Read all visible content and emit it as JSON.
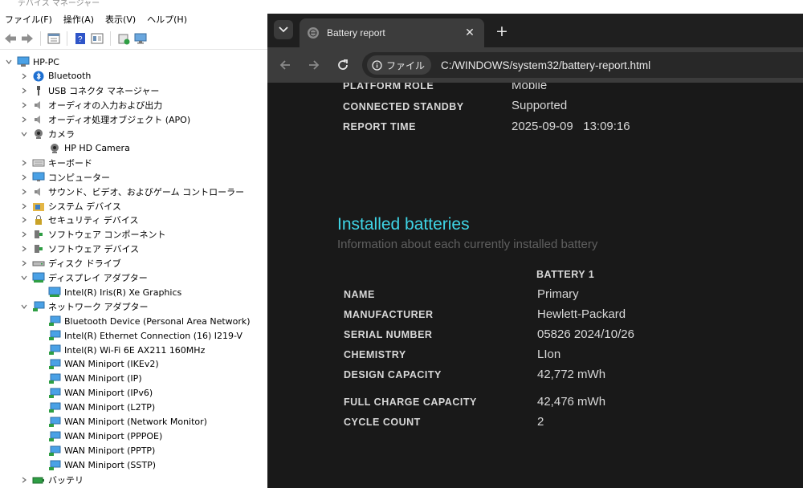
{
  "devmgr": {
    "title": "デバイス マネージャー",
    "menu": [
      "ファイル(F)",
      "操作(A)",
      "表示(V)",
      "ヘルプ(H)"
    ],
    "root": "HP-PC",
    "tree": [
      {
        "label": "Bluetooth",
        "indent": 1,
        "chevron": ">",
        "icon": "bluetooth-icon"
      },
      {
        "label": "USB コネクタ マネージャー",
        "indent": 1,
        "chevron": ">",
        "icon": "usb-icon"
      },
      {
        "label": "オーディオの入力および出力",
        "indent": 1,
        "chevron": ">",
        "icon": "speaker-icon"
      },
      {
        "label": "オーディオ処理オブジェクト (APO)",
        "indent": 1,
        "chevron": ">",
        "icon": "speaker-icon"
      },
      {
        "label": "カメラ",
        "indent": 1,
        "chevron": "v",
        "icon": "camera-icon"
      },
      {
        "label": "HP HD Camera",
        "indent": 2,
        "chevron": "",
        "icon": "camera-icon"
      },
      {
        "label": "キーボード",
        "indent": 1,
        "chevron": ">",
        "icon": "keyboard-icon"
      },
      {
        "label": "コンピューター",
        "indent": 1,
        "chevron": ">",
        "icon": "monitor-icon"
      },
      {
        "label": "サウンド、ビデオ、およびゲーム コントローラー",
        "indent": 1,
        "chevron": ">",
        "icon": "speaker-icon"
      },
      {
        "label": "システム デバイス",
        "indent": 1,
        "chevron": ">",
        "icon": "folder-chip-icon"
      },
      {
        "label": "セキュリティ デバイス",
        "indent": 1,
        "chevron": ">",
        "icon": "lock-icon"
      },
      {
        "label": "ソフトウェア コンポーネント",
        "indent": 1,
        "chevron": ">",
        "icon": "puzzle-icon"
      },
      {
        "label": "ソフトウェア デバイス",
        "indent": 1,
        "chevron": ">",
        "icon": "puzzle-icon"
      },
      {
        "label": "ディスク ドライブ",
        "indent": 1,
        "chevron": ">",
        "icon": "disk-icon"
      },
      {
        "label": "ディスプレイ アダプター",
        "indent": 1,
        "chevron": "v",
        "icon": "display-adapter-icon"
      },
      {
        "label": "Intel(R) Iris(R) Xe Graphics",
        "indent": 2,
        "chevron": "",
        "icon": "display-adapter-icon"
      },
      {
        "label": "ネットワーク アダプター",
        "indent": 1,
        "chevron": "v",
        "icon": "network-icon"
      },
      {
        "label": "Bluetooth Device (Personal Area Network)",
        "indent": 2,
        "chevron": "",
        "icon": "network-icon"
      },
      {
        "label": "Intel(R) Ethernet Connection (16) I219-V",
        "indent": 2,
        "chevron": "",
        "icon": "network-icon"
      },
      {
        "label": "Intel(R) Wi-Fi 6E AX211 160MHz",
        "indent": 2,
        "chevron": "",
        "icon": "network-icon"
      },
      {
        "label": "WAN Miniport (IKEv2)",
        "indent": 2,
        "chevron": "",
        "icon": "network-icon"
      },
      {
        "label": "WAN Miniport (IP)",
        "indent": 2,
        "chevron": "",
        "icon": "network-icon"
      },
      {
        "label": "WAN Miniport (IPv6)",
        "indent": 2,
        "chevron": "",
        "icon": "network-icon"
      },
      {
        "label": "WAN Miniport (L2TP)",
        "indent": 2,
        "chevron": "",
        "icon": "network-icon"
      },
      {
        "label": "WAN Miniport (Network Monitor)",
        "indent": 2,
        "chevron": "",
        "icon": "network-icon"
      },
      {
        "label": "WAN Miniport (PPPOE)",
        "indent": 2,
        "chevron": "",
        "icon": "network-icon"
      },
      {
        "label": "WAN Miniport (PPTP)",
        "indent": 2,
        "chevron": "",
        "icon": "network-icon"
      },
      {
        "label": "WAN Miniport (SSTP)",
        "indent": 2,
        "chevron": "",
        "icon": "network-icon"
      },
      {
        "label": "バッテリ",
        "indent": 1,
        "chevron": ">",
        "icon": "battery-icon"
      }
    ]
  },
  "browser": {
    "tab_title": "Battery report",
    "site_chip": "ファイル",
    "url": "C:/WINDOWS/system32/battery-report.html"
  },
  "report": {
    "top_rows": [
      {
        "label": "PLATFORM ROLE",
        "value": "Mobile"
      },
      {
        "label": "CONNECTED STANDBY",
        "value": "Supported"
      },
      {
        "label": "REPORT TIME",
        "value": "2025-09-09   13:09:16"
      }
    ],
    "section_title": "Installed batteries",
    "section_subtitle": "Information about each currently installed battery",
    "battery_header": "BATTERY 1",
    "battery_rows": [
      {
        "label": "NAME",
        "value": "Primary"
      },
      {
        "label": "MANUFACTURER",
        "value": "Hewlett-Packard"
      },
      {
        "label": "SERIAL NUMBER",
        "value": "05826 2024/10/26"
      },
      {
        "label": "CHEMISTRY",
        "value": "LIon"
      },
      {
        "label": "DESIGN CAPACITY",
        "value": "42,772 mWh"
      },
      {
        "label": "FULL CHARGE CAPACITY",
        "value": "42,476 mWh"
      },
      {
        "label": "CYCLE COUNT",
        "value": "2"
      }
    ]
  }
}
